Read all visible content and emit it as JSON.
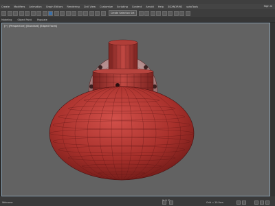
{
  "menu": [
    "Create",
    "Modifiers",
    "Animation",
    "Graph Editors",
    "Rendering",
    "Civil View",
    "Customize",
    "Scripting",
    "Content",
    "Arnold",
    "Help",
    "3DXNORMS",
    "uptoTools"
  ],
  "toolbar": {
    "selection_dropdown": "Create Selection Set"
  },
  "ribbon_tabs": [
    "Modeling",
    "Object Paint",
    "Populate"
  ],
  "account": {
    "sign_in": "Sign In"
  },
  "viewport": {
    "label": "[+] [Perspective] [Standard] [Edged Faces]",
    "colors": {
      "background": "#626262",
      "body": "#b23a34",
      "wireframe": "#5a1414"
    }
  },
  "status": {
    "left_text": "Welcome",
    "coords": "X:   Y:   Z:",
    "grid": "Grid = 10.0cm"
  }
}
